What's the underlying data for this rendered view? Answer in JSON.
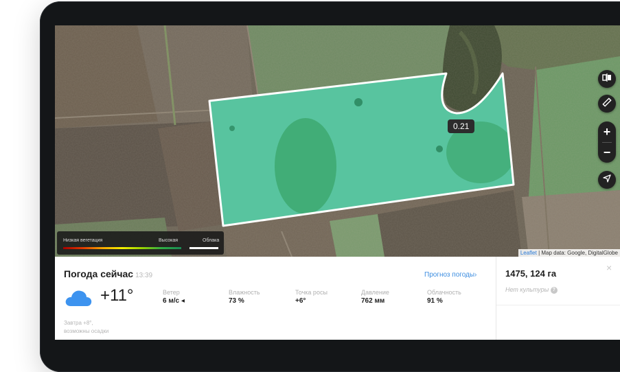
{
  "map": {
    "tooltip_value": "0.21",
    "attribution_link": "Leaflet",
    "attribution_text": " | Map data: Google, DigitalGlobe",
    "legend": {
      "low_label": "Низкая вегетация",
      "high_label": "Высокая",
      "clouds_label": "Облака"
    },
    "tools": {
      "compare": "compare-icon",
      "ruler": "ruler-icon",
      "zoom_in": "+",
      "zoom_out": "−",
      "locate": "navigation-arrow-icon"
    }
  },
  "weather": {
    "title": "Погода сейчас",
    "time": "13:39",
    "forecast_link": "Прогноз погоды›",
    "temperature": "+11°",
    "icon": "cloud-icon",
    "stats": [
      {
        "label": "Ветер",
        "value": "6 м/с ◂"
      },
      {
        "label": "Влажность",
        "value": "73 %"
      },
      {
        "label": "Точка росы",
        "value": "+6°"
      },
      {
        "label": "Давление",
        "value": "762 мм"
      },
      {
        "label": "Облачность",
        "value": "91 %"
      }
    ],
    "tomorrow_line1": "Завтра +8°,",
    "tomorrow_line2": "возможны осадки"
  },
  "field": {
    "area": "1475, 124 га",
    "crop": "Нет культуры",
    "close": "×"
  },
  "colors": {
    "accent_link": "#3c8de0",
    "frame": "#141618",
    "ndvi_low": "#a80000",
    "ndvi_high": "#1a8a55"
  }
}
